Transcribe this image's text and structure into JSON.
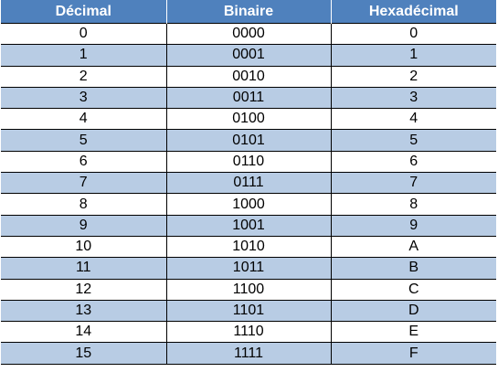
{
  "headers": [
    "Décimal",
    "Binaire",
    "Hexadécimal"
  ],
  "rows": [
    [
      "0",
      "0000",
      "0"
    ],
    [
      "1",
      "0001",
      "1"
    ],
    [
      "2",
      "0010",
      "2"
    ],
    [
      "3",
      "0011",
      "3"
    ],
    [
      "4",
      "0100",
      "4"
    ],
    [
      "5",
      "0101",
      "5"
    ],
    [
      "6",
      "0110",
      "6"
    ],
    [
      "7",
      "0111",
      "7"
    ],
    [
      "8",
      "1000",
      "8"
    ],
    [
      "9",
      "1001",
      "9"
    ],
    [
      "10",
      "1010",
      "A"
    ],
    [
      "11",
      "1011",
      "B"
    ],
    [
      "12",
      "1100",
      "C"
    ],
    [
      "13",
      "1101",
      "D"
    ],
    [
      "14",
      "1110",
      "E"
    ],
    [
      "15",
      "1111",
      "F"
    ]
  ],
  "colors": {
    "header_bg": "#4f81bd",
    "stripe_bg": "#b8cce4",
    "row_bg": "#ffffff"
  }
}
